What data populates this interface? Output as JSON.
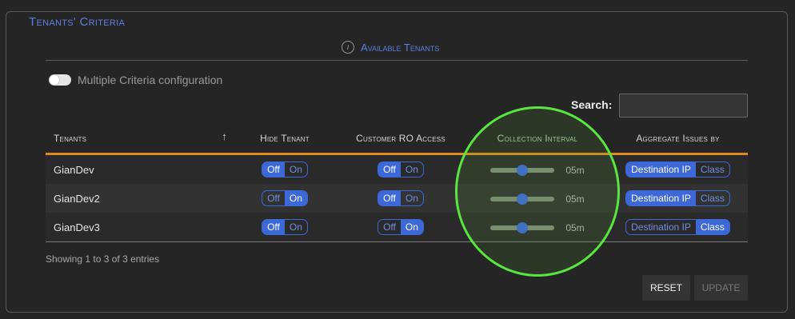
{
  "section": {
    "title": "Tenants' Criteria"
  },
  "available": {
    "label": "Available Tenants",
    "icon": "info-icon"
  },
  "multi_criteria": {
    "label": "Multiple Criteria configuration",
    "enabled": false
  },
  "search": {
    "label": "Search:",
    "value": ""
  },
  "table": {
    "headers": [
      "Tenants",
      "Hide Tenant",
      "Customer RO Access",
      "Collection Interval",
      "Aggregate Issues by"
    ],
    "rows": [
      {
        "tenant": "GianDev",
        "hide": "Off",
        "ro_access": "Off",
        "interval_value": "05m",
        "interval_fraction": 0.5,
        "aggregate": "Destination IP"
      },
      {
        "tenant": "GianDev2",
        "hide": "On",
        "ro_access": "Off",
        "interval_value": "05m",
        "interval_fraction": 0.5,
        "aggregate": "Destination IP"
      },
      {
        "tenant": "GianDev3",
        "hide": "Off",
        "ro_access": "On",
        "interval_value": "05m",
        "interval_fraction": 0.5,
        "aggregate": "Class"
      }
    ],
    "toggle_off_label": "Off",
    "toggle_on_label": "On",
    "aggregate_options": [
      "Destination IP",
      "Class"
    ]
  },
  "footer": {
    "showing": "Showing 1 to 3 of 3 entries"
  },
  "buttons": {
    "reset": "RESET",
    "update": "UPDATE"
  },
  "colors": {
    "accent": "#3d68d8",
    "header_rule": "#e08a19",
    "highlight": "#59e640"
  }
}
